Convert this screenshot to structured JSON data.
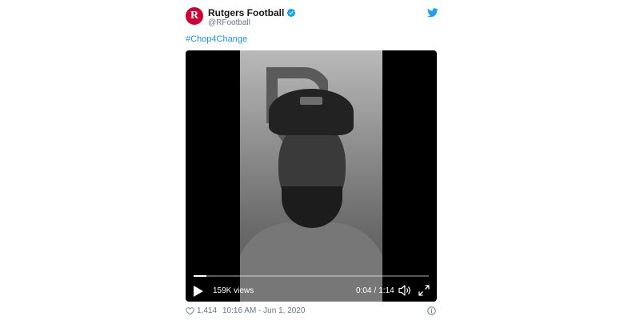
{
  "author": {
    "display_name": "Rutgers Football",
    "handle": "@RFootball",
    "avatar_letter": "R",
    "brand_color": "#cc0033"
  },
  "tweet": {
    "hashtag": "#Chop4Change"
  },
  "video": {
    "views": "159K views",
    "current_time": "0:04",
    "separator": "/",
    "duration": "1:14",
    "progress_fraction": 0.054
  },
  "footer": {
    "like_count": "1,414",
    "timestamp": "10:16 AM - Jun 1, 2020"
  },
  "colors": {
    "link": "#1b95e0",
    "secondary_text": "#657786",
    "verified": "#1da1f2"
  },
  "icons": [
    "verified-badge-icon",
    "twitter-bird-icon",
    "play-icon",
    "volume-icon",
    "fullscreen-icon",
    "heart-icon",
    "info-icon"
  ]
}
